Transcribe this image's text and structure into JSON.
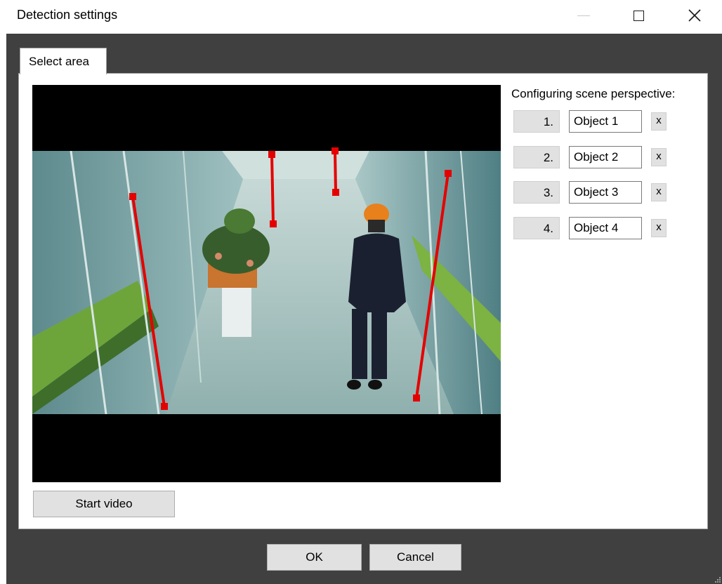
{
  "window": {
    "title": "Detection settings"
  },
  "tabs": [
    {
      "label": "Select area",
      "active": true
    }
  ],
  "perspective": {
    "heading": "Configuring scene perspective:",
    "objects": [
      {
        "number": "1.",
        "name": "Object 1",
        "remove_label": "x"
      },
      {
        "number": "2.",
        "name": "Object 2",
        "remove_label": "x"
      },
      {
        "number": "3.",
        "name": "Object 3",
        "remove_label": "x"
      },
      {
        "number": "4.",
        "name": "Object 4",
        "remove_label": "x"
      }
    ]
  },
  "buttons": {
    "start_video": "Start video",
    "ok": "OK",
    "cancel": "Cancel"
  },
  "colors": {
    "marker": "#e50000",
    "client_bg": "#404040",
    "button_bg": "#e1e1e1"
  }
}
